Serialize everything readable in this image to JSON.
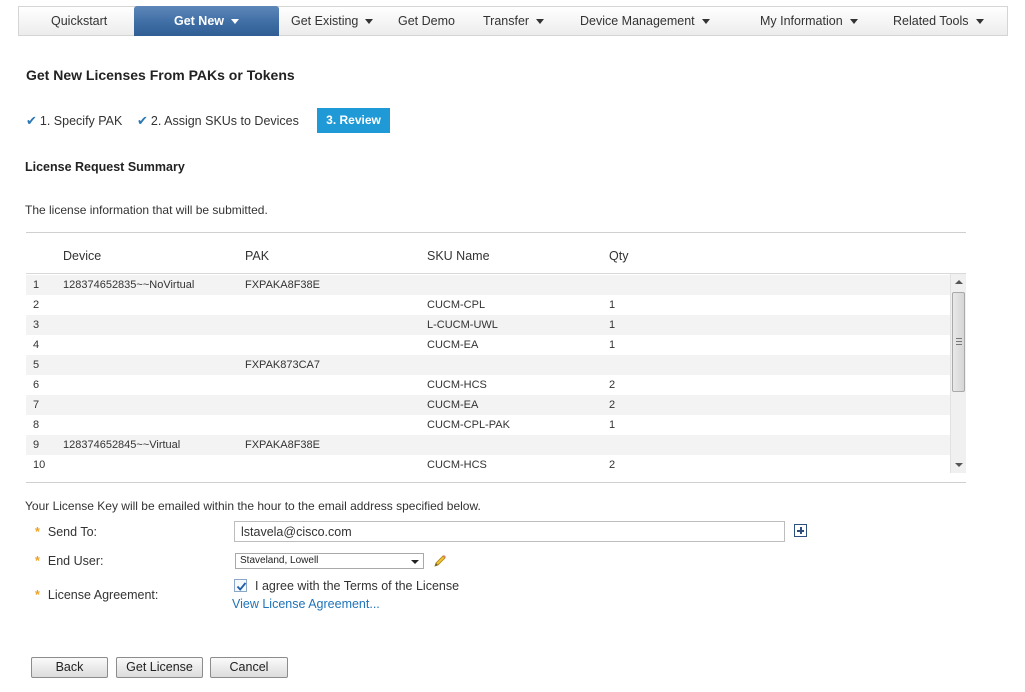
{
  "nav": {
    "quickstart": "Quickstart",
    "get_new": "Get New",
    "get_existing": "Get Existing",
    "get_demo": "Get Demo",
    "transfer": "Transfer",
    "device_management": "Device Management",
    "my_information": "My Information",
    "related_tools": "Related Tools"
  },
  "page": {
    "title": "Get New Licenses From PAKs or Tokens"
  },
  "steps": {
    "step1": "1. Specify PAK",
    "step2": "2. Assign SKUs to Devices",
    "step3": "3. Review"
  },
  "summary": {
    "title": "License Request Summary",
    "description": "The license information that will be submitted."
  },
  "table": {
    "headers": {
      "device": "Device",
      "pak": "PAK",
      "sku": "SKU Name",
      "qty": "Qty"
    },
    "rows": [
      {
        "num": "1",
        "device": "128374652835~~NoVirtual",
        "pak": "FXPAKA8F38E",
        "sku": "",
        "qty": ""
      },
      {
        "num": "2",
        "device": "",
        "pak": "",
        "sku": "CUCM-CPL",
        "qty": "1"
      },
      {
        "num": "3",
        "device": "",
        "pak": "",
        "sku": "L-CUCM-UWL",
        "qty": "1"
      },
      {
        "num": "4",
        "device": "",
        "pak": "",
        "sku": "CUCM-EA",
        "qty": "1"
      },
      {
        "num": "5",
        "device": "",
        "pak": "FXPAK873CA7",
        "sku": "",
        "qty": ""
      },
      {
        "num": "6",
        "device": "",
        "pak": "",
        "sku": "CUCM-HCS",
        "qty": "2"
      },
      {
        "num": "7",
        "device": "",
        "pak": "",
        "sku": "CUCM-EA",
        "qty": "2"
      },
      {
        "num": "8",
        "device": "",
        "pak": "",
        "sku": "CUCM-CPL-PAK",
        "qty": "1"
      },
      {
        "num": "9",
        "device": "128374652845~~Virtual",
        "pak": "FXPAKA8F38E",
        "sku": "",
        "qty": ""
      },
      {
        "num": "10",
        "device": "",
        "pak": "",
        "sku": "CUCM-HCS",
        "qty": "2"
      }
    ]
  },
  "form": {
    "info_line": "Your License Key will be emailed within the hour to the email address specified below.",
    "send_to_label": "Send To:",
    "send_to_value": "lstavela@cisco.com",
    "end_user_label": "End User:",
    "end_user_value": "Staveland, Lowell",
    "agreement_label": "License Agreement:",
    "agree_text": "I agree with the Terms of the License",
    "view_link": "View License Agreement..."
  },
  "buttons": {
    "back": "Back",
    "get_license": "Get License",
    "cancel": "Cancel"
  },
  "colors": {
    "nav_active": "#3f6ea5",
    "step_active": "#1f9ad6",
    "link": "#1f73b8",
    "required": "#f0a021"
  }
}
